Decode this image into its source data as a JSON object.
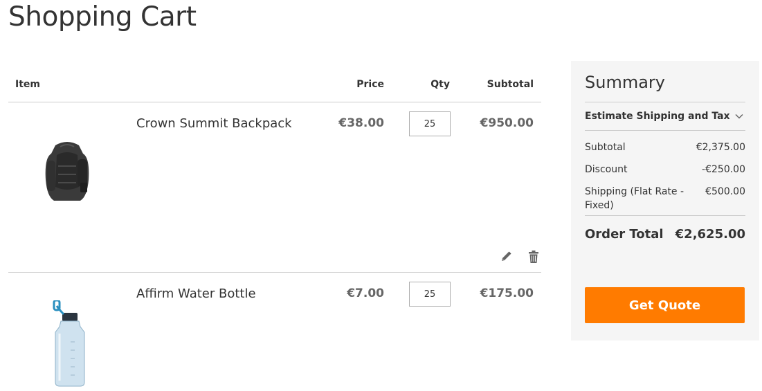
{
  "page": {
    "title": "Shopping Cart"
  },
  "cart": {
    "headers": {
      "item": "Item",
      "price": "Price",
      "qty": "Qty",
      "subtotal": "Subtotal"
    },
    "items": [
      {
        "name": "Crown Summit Backpack",
        "price": "€38.00",
        "qty": "25",
        "subtotal": "€950.00",
        "image_icon": "backpack-image"
      },
      {
        "name": "Affirm Water Bottle",
        "price": "€7.00",
        "qty": "25",
        "subtotal": "€175.00",
        "image_icon": "water-bottle-image"
      }
    ],
    "actions": {
      "edit_icon": "pencil-icon",
      "delete_icon": "trash-icon"
    }
  },
  "summary": {
    "title": "Summary",
    "estimate_label": "Estimate Shipping and Tax",
    "lines": [
      {
        "label": "Subtotal",
        "value": "€2,375.00"
      },
      {
        "label": "Discount",
        "value": "-€250.00"
      },
      {
        "label": "Shipping (Flat Rate - Fixed)",
        "value": "€500.00"
      }
    ],
    "order_total_label": "Order Total",
    "order_total_value": "€2,625.00",
    "button_label": "Get Quote"
  },
  "colors": {
    "accent": "#ff7b00",
    "summary_bg": "#f5f5f5",
    "border": "#cccccc"
  }
}
